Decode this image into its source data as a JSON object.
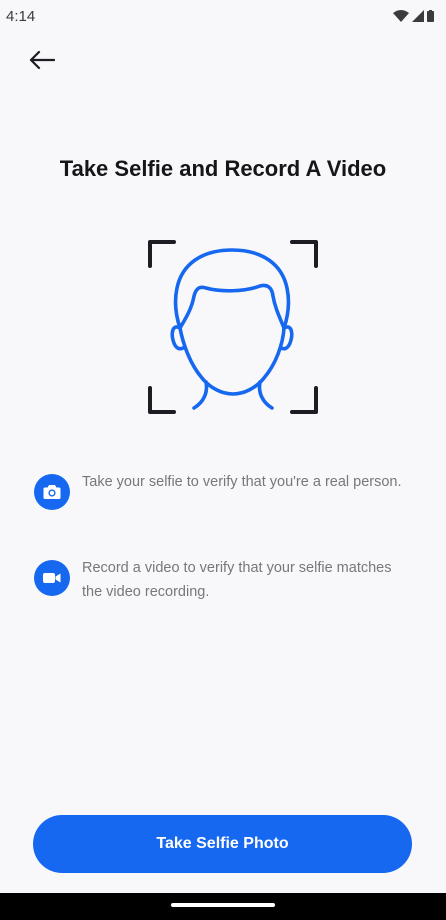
{
  "status_bar": {
    "time": "4:14"
  },
  "header": {
    "title": "Take Selfie and Record A Video"
  },
  "info_items": [
    {
      "icon": "camera-icon",
      "text": "Take your selfie to verify that you're a real person."
    },
    {
      "icon": "video-camera-icon",
      "text": "Record a video to verify that your selfie matches the video recording."
    }
  ],
  "actions": {
    "primary_label": "Take Selfie Photo"
  },
  "colors": {
    "accent": "#1668f0",
    "background": "#f8f8fa",
    "title": "#15151a",
    "body_text": "#77777c",
    "frame_corners": "#1c1c22"
  }
}
